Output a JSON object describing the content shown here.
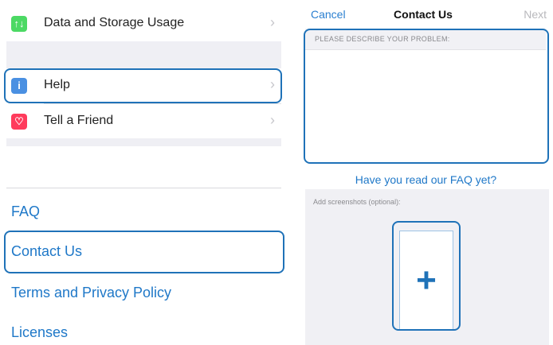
{
  "settings": {
    "items": [
      {
        "label": "Data and Storage Usage",
        "icon": "arrows-updown-icon",
        "icon_glyph": "↑↓",
        "icon_color": "#4cd964"
      },
      {
        "label": "Help",
        "icon": "info-icon",
        "icon_glyph": "i",
        "icon_color": "#4a90e2"
      },
      {
        "label": "Tell a Friend",
        "icon": "heart-icon",
        "icon_glyph": "♡",
        "icon_color": "#ff3b5c"
      }
    ],
    "chevron": "›"
  },
  "help_links": [
    "FAQ",
    "Contact Us",
    "Terms and Privacy Policy",
    "Licenses"
  ],
  "contact": {
    "nav": {
      "left": "Cancel",
      "title": "Contact Us",
      "right": "Next"
    },
    "problem_header": "PLEASE DESCRIBE YOUR PROBLEM:",
    "problem_value": "",
    "faq_link": "Have you read our FAQ yet?",
    "screenshots_label": "Add screenshots (optional):",
    "add_glyph": "+"
  },
  "colors": {
    "accent": "#1f72b8",
    "link": "#1f78c8",
    "highlight": "#1f72b8"
  }
}
